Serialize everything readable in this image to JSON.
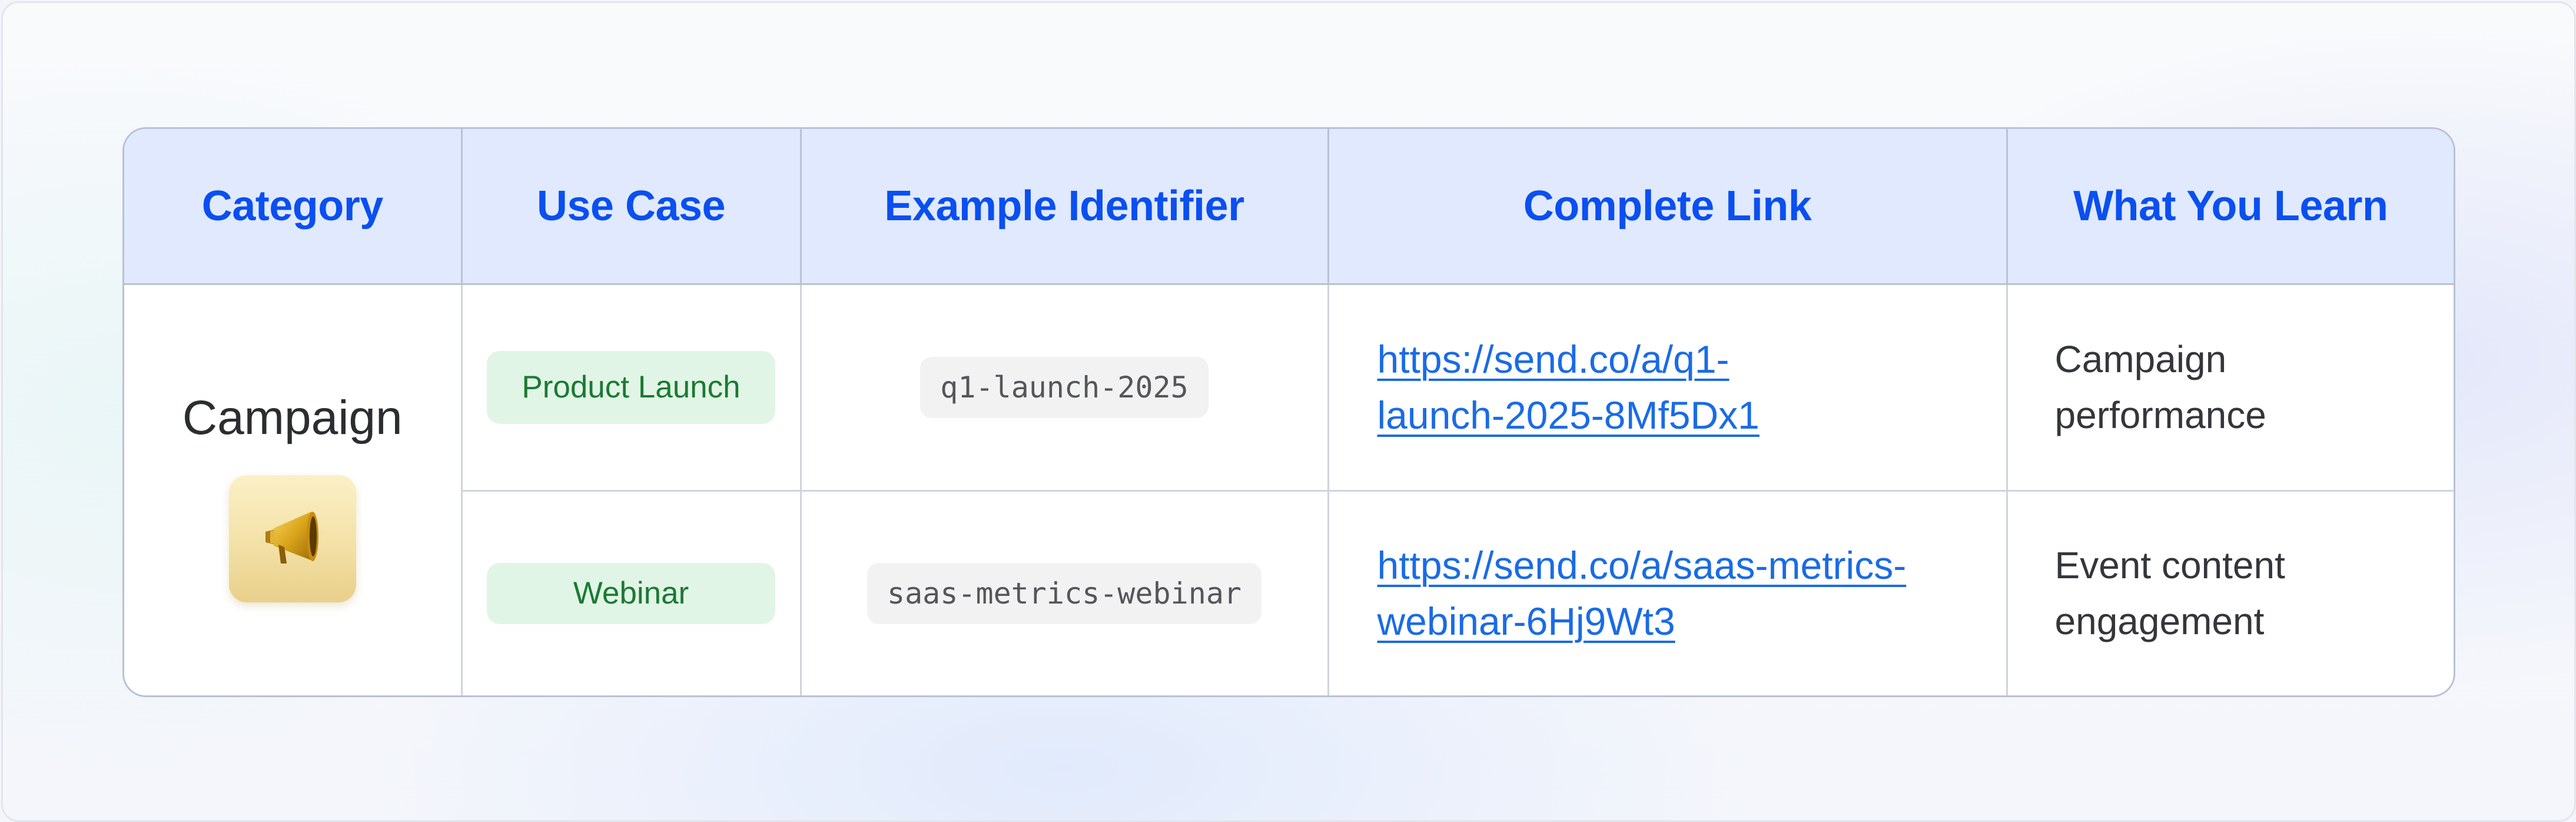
{
  "table": {
    "headers": [
      "Category",
      "Use Case",
      "Example Identifier",
      "Complete Link",
      "What You Learn"
    ],
    "category": {
      "label": "Campaign",
      "icon": "megaphone-icon"
    },
    "rows": [
      {
        "use_case": "Product Launch",
        "identifier": "q1-launch-2025",
        "link_line1": "https://send.co/a/q1-",
        "link_line2": "launch-2025-8Mf5Dx1",
        "learn_line1": "Campaign",
        "learn_line2": "performance"
      },
      {
        "use_case": "Webinar",
        "identifier": "saas-metrics-webinar",
        "link_line1": "https://send.co/a/saas-metrics-",
        "link_line2": "webinar-6Hj9Wt3",
        "learn_line1": "Event content",
        "learn_line2": "engagement"
      }
    ]
  },
  "colors": {
    "header_background": "#e0e9fd",
    "header_text": "#0a4ff0",
    "link": "#1a6be6",
    "pill_background": "#e1f5e6",
    "pill_text": "#1a7a32"
  }
}
